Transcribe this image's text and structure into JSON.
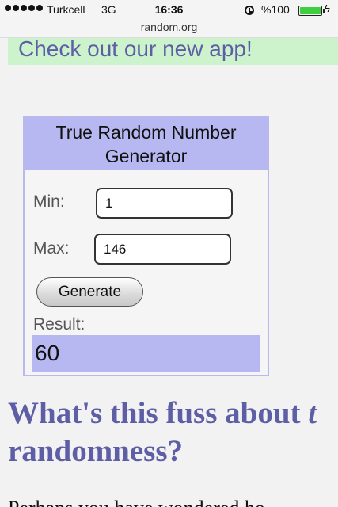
{
  "status_bar": {
    "carrier": "Turkcell",
    "network": "3G",
    "time": "16:36",
    "battery": "%100",
    "icons": [
      "signal-dots-icon",
      "alarm-icon",
      "battery-icon",
      "charging-bolt-icon"
    ]
  },
  "browser": {
    "url": "random.org"
  },
  "promo": {
    "text": "Check out our new app!"
  },
  "generator": {
    "title_line1": "True Random Number",
    "title_line2": "Generator",
    "min_label": "Min:",
    "min_value": "1",
    "max_label": "Max:",
    "max_value": "146",
    "generate_label": "Generate",
    "result_label": "Result:",
    "result_value": "60"
  },
  "article": {
    "heading_part1": "What's this fuss about ",
    "heading_italic": "t",
    "heading_line2": "randomness?",
    "body_start": "Perhaps you have wondered ho"
  },
  "colors": {
    "accent_lavender": "#b7b7f2",
    "heading_purple": "#5d5ea5",
    "promo_green": "#cdf3cd",
    "battery_green": "#3ecf3e"
  }
}
